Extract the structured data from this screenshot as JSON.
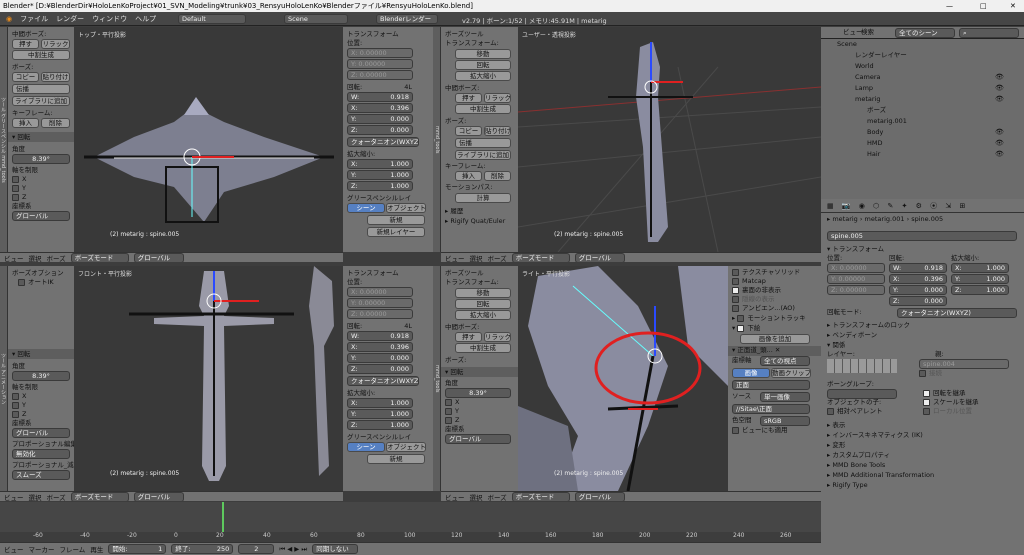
{
  "window": {
    "title": "Blender* [D:¥BlenderDir¥HoloLenKoProject¥01_SVN_Modeling¥trunk¥03_RensyuHoloLenKo¥Blenderファイル¥RensyuHoloLenKo.blend]",
    "min": "—",
    "max": "□",
    "close": "✕"
  },
  "infobar": {
    "menus": [
      "ファイル",
      "レンダー",
      "ウィンドウ",
      "ヘルプ"
    ],
    "layout": "Default",
    "scene": "Scene",
    "engine": "Blenderレンダー",
    "stats": "v2.79 | ボーン:1/52 | メモリ:45.91M | metarig"
  },
  "tabs_left": [
    "ツール",
    "作成",
    "リレーション",
    "アニメーション",
    "物理演算",
    "グリースペンシル",
    "mmd_tools"
  ],
  "toolshelf_top": {
    "section_edit": "中間ボーズ:",
    "push": "押す",
    "relax": "リラック",
    "breakdown": "中割生成",
    "pose_label": "ボーズ:",
    "copy": "コピー",
    "paste": "貼り付け",
    "flip": "伝播",
    "library": "ライブラリに追加",
    "keyframe_label": "キーフレーム:",
    "insert": "挿入",
    "delete": "削除",
    "rotate_header": "回転",
    "angle_label": "角度",
    "angle_value": "8.39°",
    "axis_label": "軸を制限",
    "x": "X",
    "y": "Y",
    "z": "Z",
    "orient_label": "座標系",
    "orient_value": "グローバル"
  },
  "toolshelf_bot": {
    "pose_options": "ボーズオプション",
    "autoik": "オートIK",
    "rotate_header": "回転",
    "angle_label": "角度",
    "angle_value": "8.39°",
    "axis_label": "軸を制限",
    "x": "X",
    "y": "Y",
    "z": "Z",
    "orient_label": "座標系",
    "orient_value": "グローバル",
    "prop_label": "プロポーショナル編集",
    "prop_value": "無効化",
    "falloff_label": "プロポーショナル_減衰タイ",
    "falloff_value": "スムーズ"
  },
  "props_mid": {
    "transform": "トランスフォーム",
    "location": "位置:",
    "x_label": "X:",
    "y_label": "Y:",
    "z_label": "Z:",
    "w_label": "W:",
    "zero": "0.00000",
    "rotation": "回転:",
    "rot_mode": "4L",
    "w": "0.918",
    "x": "0.396",
    "y": "0.000",
    "z": "0.000",
    "quat": "クォータニオン(WXYZ)",
    "scale": "拡大縮小:",
    "one": "1.000",
    "grease": "グリースペンシルレイ",
    "scene_btn": "シーン",
    "object_btn": "オブジェクト",
    "new": "新規",
    "new_layer": "新規レイヤー"
  },
  "toolshelf_right_top": {
    "posetools": "ボーズツール",
    "transform": "トランスフォーム:",
    "move": "移動",
    "rotate": "回転",
    "scale": "拡大縮小",
    "inbetween": "中間ボーズ:",
    "push": "押す",
    "relax": "リラック",
    "breakdown": "中割生成",
    "pose": "ボーズ:",
    "copy": "コピー",
    "paste": "貼り付け",
    "flip": "伝播",
    "library": "ライブラリに追加",
    "keyframe": "キーフレーム:",
    "insert": "挿入",
    "delete": "削除",
    "motion": "モーションパス:",
    "calc": "計算",
    "history": "履歴",
    "rigify": "Rigify Quat/Euler"
  },
  "toolshelf_right_bot": {
    "posetools": "ボーズツール",
    "transform": "トランスフォーム:",
    "move": "移動",
    "rotate": "回転",
    "scale": "拡大縮小",
    "inbetween": "中間ボーズ:",
    "push": "押す",
    "relax": "リラック",
    "breakdown": "中割生成",
    "pose": "ボーズ:",
    "rotate_header": "回転",
    "angle": "角度",
    "angle_value": "8.39°",
    "x": "X",
    "y": "Y",
    "z": "Z",
    "orient": "座標系",
    "orient_value": "グローバル"
  },
  "viewports": {
    "tl_title": "トップ・平行投影",
    "tr_title": "ユーザー・透視投影",
    "bl_title": "フロント・平行投影",
    "br_title": "ライト・平行投影",
    "info": "(2) metarig : spine.005"
  },
  "vpbar": {
    "view": "ビュー",
    "select": "選択",
    "pose": "ボーズ",
    "mode": "ボーズモード",
    "global": "グローバル"
  },
  "display_panel": {
    "texture_solid": "テクスチャソリッド",
    "matcap": "Matcap",
    "backface": "裏面の非表示",
    "hidden_wire": "隠線の表示",
    "ao": "アンビエン...(AO)",
    "motion_track": "モーショントラッキ",
    "bg": "下絵",
    "add_image": "画像を追加",
    "front": "正面道_頭...",
    "axis_label": "座標軸",
    "axis_value": "全ての視点",
    "image": "画像",
    "movieclip": "動画クリップ",
    "front2": "正面",
    "source": "ソース",
    "source_value": "単一画像",
    "file": "//Sitae\\正面",
    "colorspace": "色空間",
    "colorspace_value": "sRGB",
    "viewalign": "ビューにも適用"
  },
  "outliner": {
    "view": "ビュー",
    "search": "検索",
    "filter": "全てのシーン",
    "items": [
      "Scene",
      "レンダーレイヤー",
      "World",
      "Camera",
      "Lamp",
      "metarig",
      "ボーズ",
      "metarig.001",
      "Body",
      "HMD",
      "Hair"
    ]
  },
  "props": {
    "breadcrumb": [
      "metarig",
      "metarig.001",
      "spine.005"
    ],
    "bone": "spine.005",
    "transform": "トランスフォーム",
    "location": "位置:",
    "rotation": "回転:",
    "scale": "拡大縮小:",
    "zero": "0.00000",
    "w": "0.918",
    "x": "0.396",
    "y": "0.000",
    "z": "0.000",
    "one": "1.000",
    "mode_label": "回転モード:",
    "mode": "クォータニオン(WXYZ)",
    "lock": "トランスフォームのロック",
    "bendy": "ベンディボーン",
    "relations": "関係",
    "layer": "レイヤー:",
    "parent": "親:",
    "parent_value": "spine.004",
    "connected": "接続",
    "bone_group": "ボーングループ:",
    "inherit_rot": "回転を継承",
    "inherit_scale": "スケールを継承",
    "object_children": "オブジェクトの子:",
    "local_loc": "ローカル位置",
    "relative_parent": "相対ペアレント",
    "display": "表示",
    "ik": "インバースキネマティクス (IK)",
    "deform": "変形",
    "custom": "カスタムプロパティ",
    "mmd": "MMD Bone Tools",
    "mmd2": "MMD Additional Transformation",
    "rigify": "Rigify Type"
  },
  "timeline": {
    "ticks": [
      "-60",
      "-40",
      "-20",
      "0",
      "20",
      "40",
      "60",
      "80",
      "100",
      "120",
      "140",
      "160",
      "180",
      "200",
      "220",
      "240",
      "260",
      "280"
    ],
    "view": "ビュー",
    "marker": "マーカー",
    "frame": "フレーム",
    "play": "再生",
    "start_label": "開始:",
    "start": "1",
    "end_label": "終了:",
    "end": "250",
    "current": "2",
    "sync": "同期しない"
  },
  "colors": {
    "bg": "#3d3d3d",
    "panel": "#727272",
    "viewport": "#393939",
    "accent": "#5680c2",
    "select": "#e57a14",
    "highlight_ring": "#e02020"
  }
}
